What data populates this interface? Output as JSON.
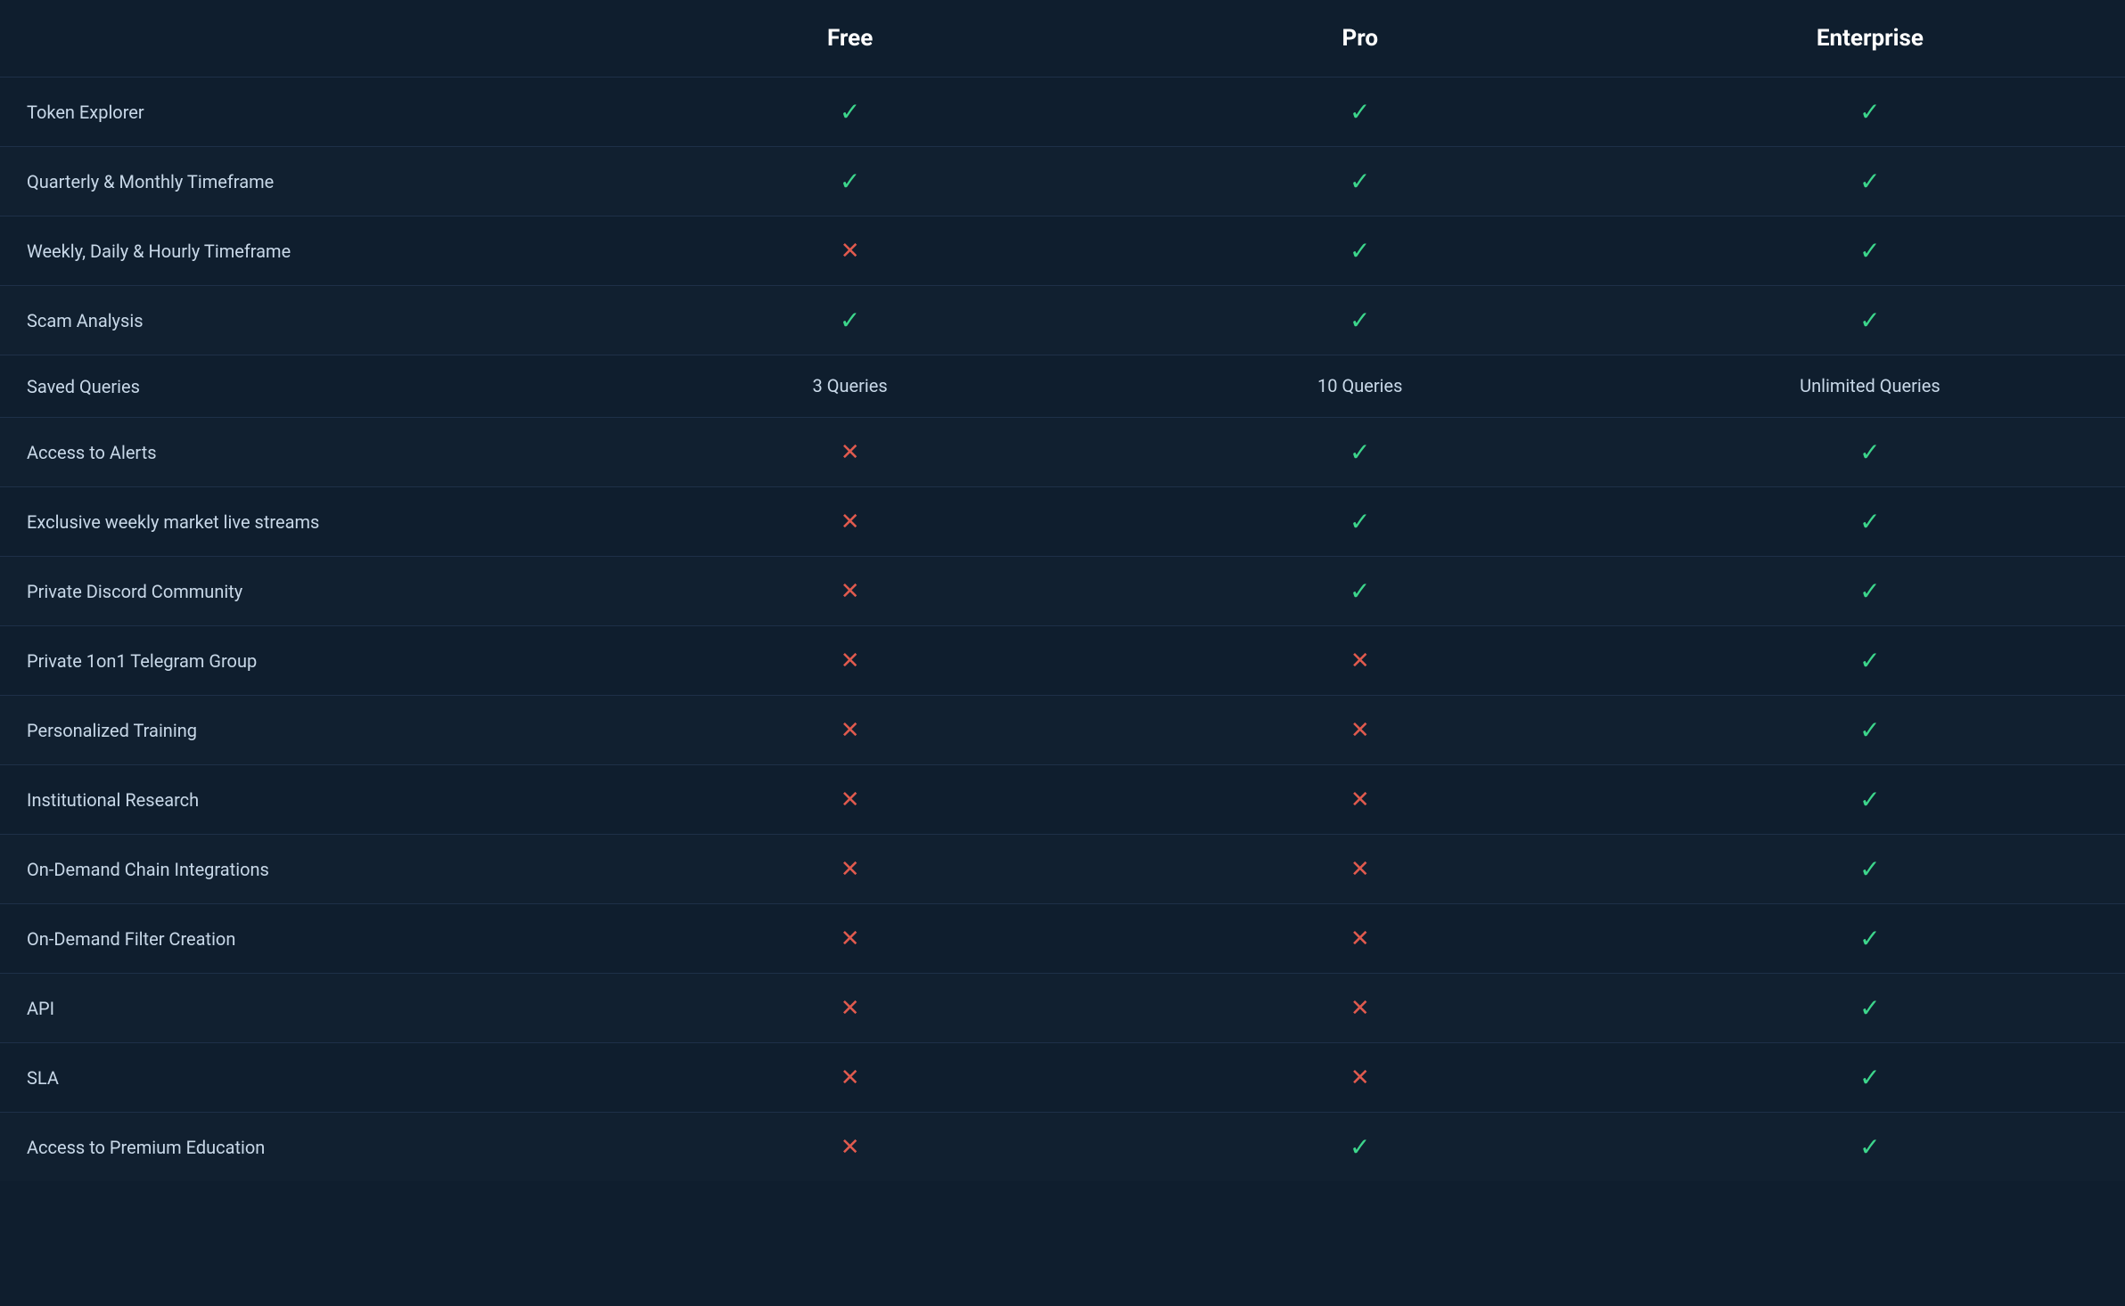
{
  "header": {
    "col1": "",
    "col2": "Free",
    "col3": "Pro",
    "col4": "Enterprise"
  },
  "rows": [
    {
      "feature": "Token Explorer",
      "free": "check",
      "pro": "check",
      "enterprise": "check"
    },
    {
      "feature": "Quarterly & Monthly Timeframe",
      "free": "check",
      "pro": "check",
      "enterprise": "check"
    },
    {
      "feature": "Weekly, Daily & Hourly Timeframe",
      "free": "cross",
      "pro": "check",
      "enterprise": "check"
    },
    {
      "feature": "Scam Analysis",
      "free": "check",
      "pro": "check",
      "enterprise": "check"
    },
    {
      "feature": "Saved Queries",
      "free": "3 Queries",
      "pro": "10 Queries",
      "enterprise": "Unlimited Queries"
    },
    {
      "feature": "Access to Alerts",
      "free": "cross",
      "pro": "check",
      "enterprise": "check"
    },
    {
      "feature": "Exclusive weekly market live streams",
      "free": "cross",
      "pro": "check",
      "enterprise": "check"
    },
    {
      "feature": "Private Discord Community",
      "free": "cross",
      "pro": "check",
      "enterprise": "check"
    },
    {
      "feature": "Private 1on1 Telegram Group",
      "free": "cross",
      "pro": "cross",
      "enterprise": "check"
    },
    {
      "feature": "Personalized Training",
      "free": "cross",
      "pro": "cross",
      "enterprise": "check"
    },
    {
      "feature": "Institutional Research",
      "free": "cross",
      "pro": "cross",
      "enterprise": "check"
    },
    {
      "feature": "On-Demand Chain Integrations",
      "free": "cross",
      "pro": "cross",
      "enterprise": "check"
    },
    {
      "feature": "On-Demand Filter Creation",
      "free": "cross",
      "pro": "cross",
      "enterprise": "check"
    },
    {
      "feature": "API",
      "free": "cross",
      "pro": "cross",
      "enterprise": "check"
    },
    {
      "feature": "SLA",
      "free": "cross",
      "pro": "cross",
      "enterprise": "check"
    },
    {
      "feature": "Access to Premium Education",
      "free": "cross",
      "pro": "check",
      "enterprise": "check"
    }
  ],
  "symbols": {
    "check": "✓",
    "cross": "✕"
  }
}
